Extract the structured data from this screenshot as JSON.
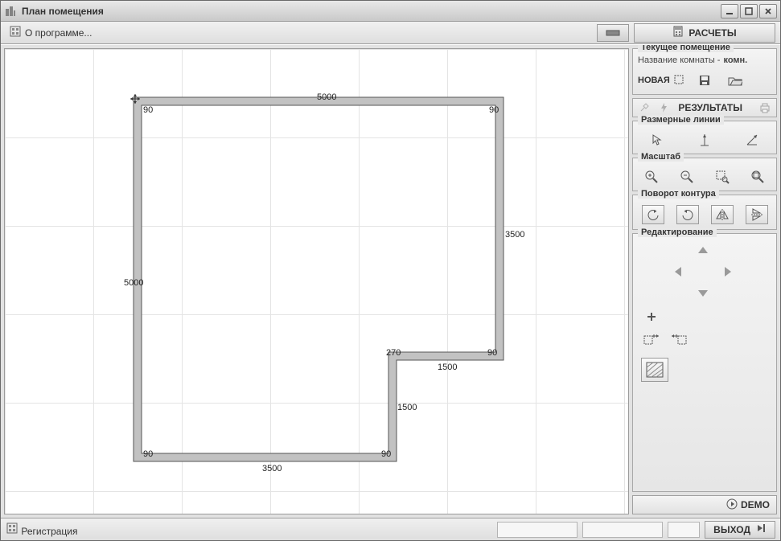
{
  "window": {
    "title": "План помещения"
  },
  "topbar": {
    "about": "О программе...",
    "calc": "РАСЧЕТЫ"
  },
  "sidebar": {
    "current_room": {
      "legend": "Текущее помещение",
      "label": "Название комнаты -",
      "value": "комн.",
      "new": "НОВАЯ"
    },
    "results": "РЕЗУЛЬТАТЫ",
    "dim_lines": "Размерные линии",
    "scale": "Масштаб",
    "rotate": "Поворот контура",
    "edit": "Редактирование",
    "demo": "DEMO"
  },
  "bottombar": {
    "register": "Регистрация",
    "exit": "ВЫХОД"
  },
  "plan": {
    "dims": {
      "top": "5000",
      "tr_angle": "90",
      "tl_angle": "90",
      "left": "5000",
      "right": "3500",
      "mr_angle": "90",
      "notch_w": "270",
      "step_w": "1500",
      "step_h": "1500",
      "bl_angle": "90",
      "b_angle": "90",
      "bottom": "3500"
    }
  }
}
